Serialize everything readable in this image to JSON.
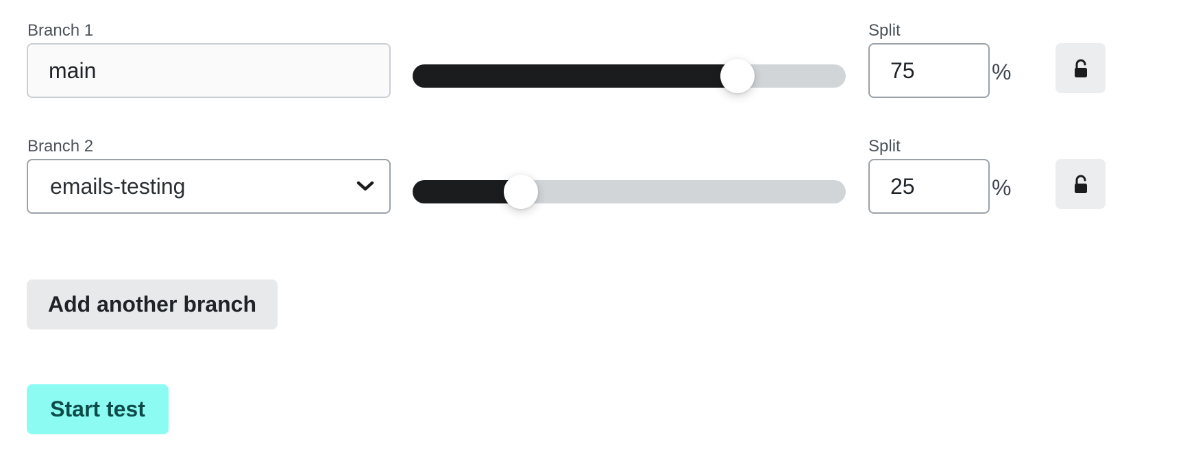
{
  "branches": [
    {
      "label": "Branch 1",
      "value": "main",
      "control": "text",
      "split_label": "Split",
      "split_value": "75",
      "split_unit": "%",
      "slider_percent": 75
    },
    {
      "label": "Branch 2",
      "value": "emails-testing",
      "control": "select",
      "split_label": "Split",
      "split_value": "25",
      "split_unit": "%",
      "slider_percent": 25
    }
  ],
  "actions": {
    "add_branch_label": "Add another branch",
    "start_test_label": "Start test"
  },
  "colors": {
    "slider_fill": "#1b1c1e",
    "slider_track": "#d2d5d8",
    "primary_button_bg": "#8cfcf3",
    "primary_button_text": "#0d4b48",
    "secondary_button_bg": "#e8e9eb"
  },
  "icons": {
    "lock": "unlocked-padlock-icon",
    "select": "chevron-down-icon"
  }
}
